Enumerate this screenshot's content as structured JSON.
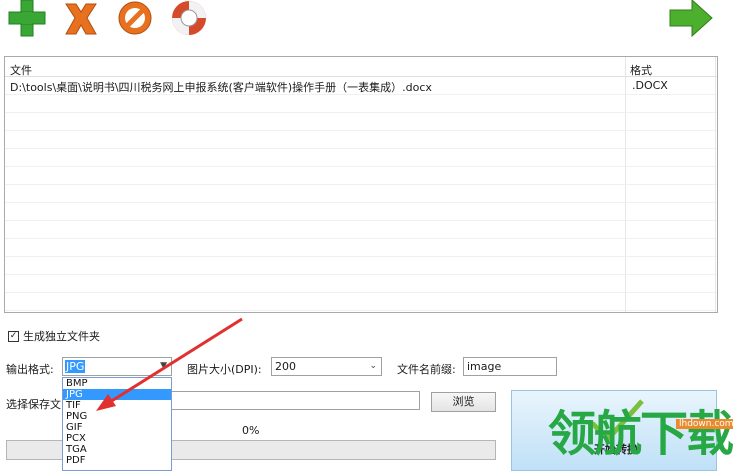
{
  "toolbar": {
    "buttons": [
      {
        "name": "add-icon",
        "color": "#3aa635"
      },
      {
        "name": "delete-icon",
        "color": "#e8711f"
      },
      {
        "name": "clear-icon",
        "color": "#e8711f"
      },
      {
        "name": "help-lifebuoy-icon",
        "color": "#d64a2c"
      }
    ],
    "next_icon": "arrow-right-icon",
    "next_color": "#4caf2e"
  },
  "file_list": {
    "col_file": "文件",
    "col_format": "格式",
    "rows": [
      {
        "path": "D:\\tools\\桌面\\说明书\\四川税务网上申报系统(客户端软件)操作手册（一表集成）.docx",
        "format": ".DOCX"
      }
    ]
  },
  "options": {
    "separate_folder_checked": true,
    "separate_folder_label": "生成独立文件夹",
    "output_format_label": "输出格式:",
    "output_format_value": "JPG",
    "dpi_label": "图片大小(DPI):",
    "dpi_value": "200",
    "prefix_label": "文件名前缀:",
    "prefix_value": "image",
    "save_dir_label": "选择保存文",
    "browse_label": "浏览"
  },
  "dropdown": {
    "items": [
      "BMP",
      "JPG",
      "TIF",
      "PNG",
      "GIF",
      "PCX",
      "TGA",
      "PDF"
    ],
    "selected": "JPG"
  },
  "progress": {
    "percent_text": "0%",
    "value": 0
  },
  "start_button": {
    "label": "开始转换"
  },
  "watermark": {
    "text": "领航下载",
    "url": "lhdown.com"
  },
  "colors": {
    "annotation_arrow": "#e03030",
    "selection": "#3399ff"
  }
}
